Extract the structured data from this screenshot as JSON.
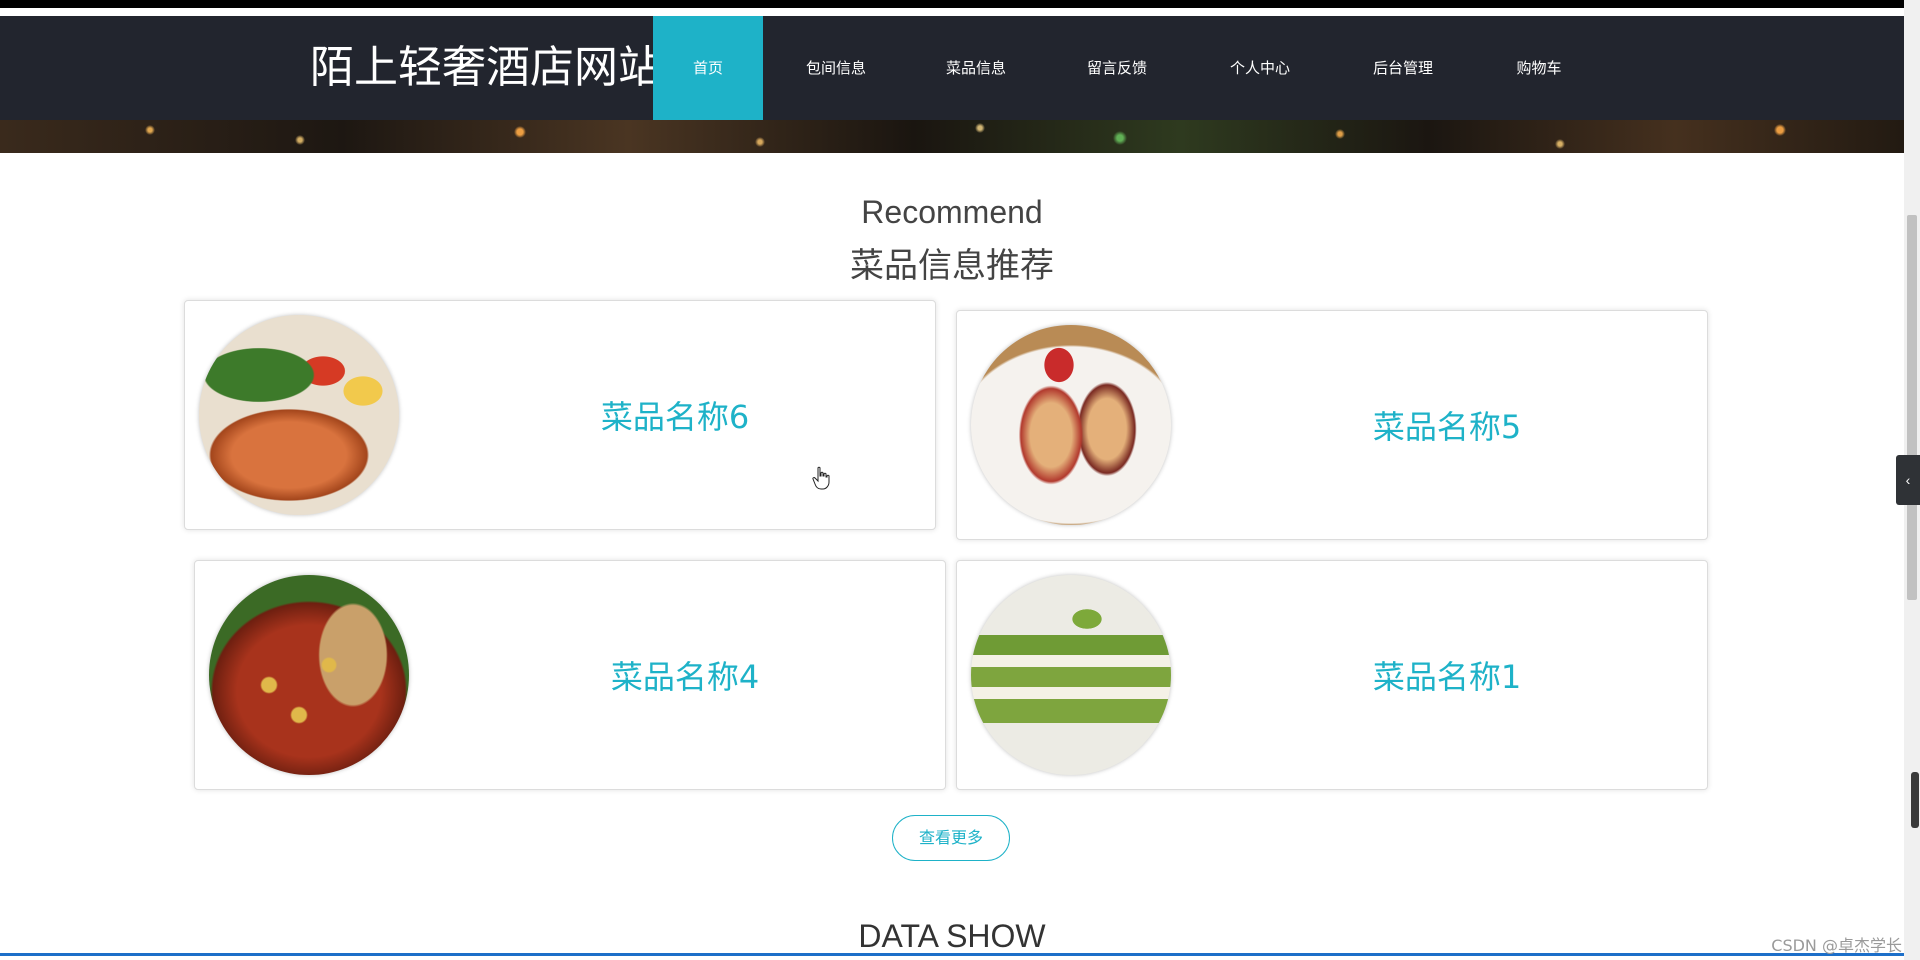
{
  "header": {
    "site_title": "陌上轻奢酒店网站",
    "nav_items": [
      {
        "label": "首页",
        "active": true
      },
      {
        "label": "包间信息",
        "active": false
      },
      {
        "label": "菜品信息",
        "active": false
      },
      {
        "label": "留言反馈",
        "active": false
      },
      {
        "label": "个人中心",
        "active": false
      },
      {
        "label": "后台管理",
        "active": false
      },
      {
        "label": "购物车",
        "active": false
      }
    ]
  },
  "recommend": {
    "heading_en": "Recommend",
    "heading_cn": "菜品信息推荐",
    "items": [
      {
        "name": "菜品名称6",
        "image": "grilled-salmon-salad"
      },
      {
        "name": "菜品名称5",
        "image": "strawberry-crepe-rolls"
      },
      {
        "name": "菜品名称4",
        "image": "spicy-noodle-soup"
      },
      {
        "name": "菜品名称1",
        "image": "matcha-layer-cake"
      }
    ],
    "more_button": "查看更多"
  },
  "data_show": {
    "heading": "DATA SHOW"
  },
  "side_toggle": {
    "icon": "chevron-left-icon",
    "glyph": "‹"
  },
  "watermark": "CSDN @卓杰学长",
  "colors": {
    "accent": "#1eb2c8",
    "navbar": "#22252e"
  }
}
